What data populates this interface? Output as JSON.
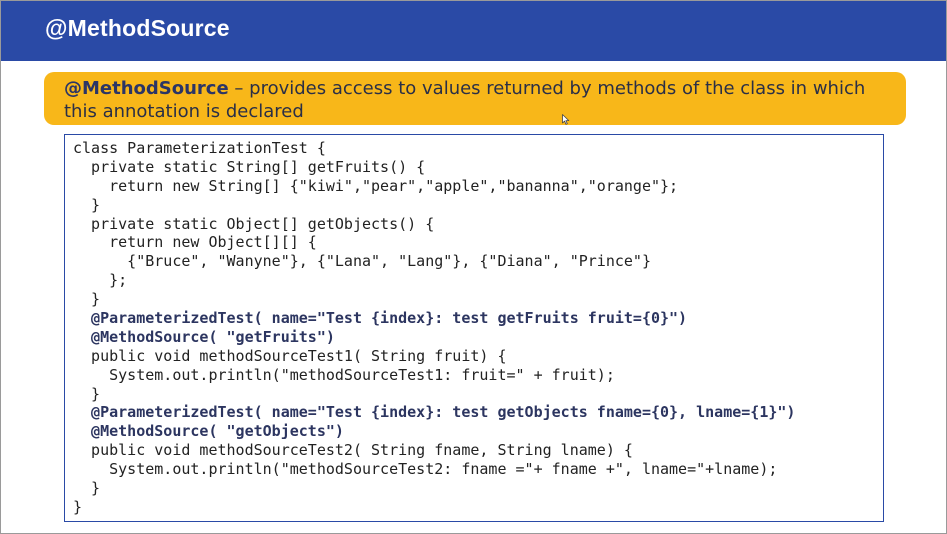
{
  "slide": {
    "title": "@MethodSource",
    "callout": {
      "term": "@MethodSource",
      "text": " – provides access to values returned by methods of the class in which this annotation is declared"
    },
    "code_lines": [
      {
        "text": "class ParameterizationTest {",
        "annotation": false
      },
      {
        "text": "  private static String[] getFruits() {",
        "annotation": false
      },
      {
        "text": "    return new String[] {\"kiwi\",\"pear\",\"apple\",\"bananna\",\"orange\"};",
        "annotation": false
      },
      {
        "text": "  }",
        "annotation": false
      },
      {
        "text": "  private static Object[] getObjects() {",
        "annotation": false
      },
      {
        "text": "    return new Object[][] {",
        "annotation": false
      },
      {
        "text": "      {\"Bruce\", \"Wanyne\"}, {\"Lana\", \"Lang\"}, {\"Diana\", \"Prince\"}",
        "annotation": false
      },
      {
        "text": "    };",
        "annotation": false
      },
      {
        "text": "  }",
        "annotation": false
      },
      {
        "text": "  @ParameterizedTest( name=\"Test {index}: test getFruits fruit={0}\")",
        "annotation": true
      },
      {
        "text": "  @MethodSource( \"getFruits\")",
        "annotation": true
      },
      {
        "text": "  public void methodSourceTest1( String fruit) {",
        "annotation": false
      },
      {
        "text": "    System.out.println(\"methodSourceTest1: fruit=\" + fruit);",
        "annotation": false
      },
      {
        "text": "  }",
        "annotation": false
      },
      {
        "text": "  @ParameterizedTest( name=\"Test {index}: test getObjects fname={0}, lname={1}\")",
        "annotation": true
      },
      {
        "text": "  @MethodSource( \"getObjects\")",
        "annotation": true
      },
      {
        "text": "  public void methodSourceTest2( String fname, String lname) {",
        "annotation": false
      },
      {
        "text": "    System.out.println(\"methodSourceTest2: fname =\"+ fname +\", lname=\"+lname);",
        "annotation": false
      },
      {
        "text": "  }",
        "annotation": false
      },
      {
        "text": "}",
        "annotation": false
      }
    ]
  },
  "colors": {
    "header": "#2a4aa6",
    "callout": "#f8b719",
    "code_border": "#2a4aa6",
    "annotation_text": "#2c3560"
  },
  "icons": {
    "cursor": "mouse-pointer-icon"
  }
}
